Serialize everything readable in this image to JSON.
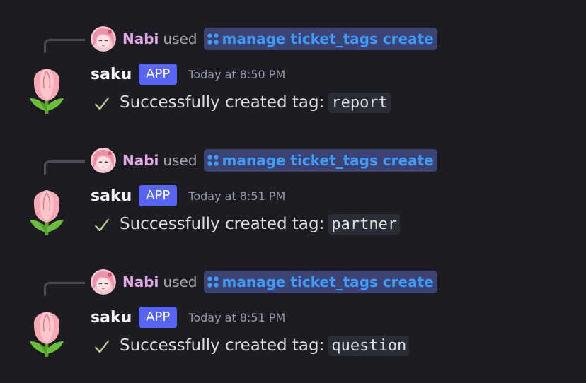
{
  "colors": {
    "background": "#1c1c22",
    "reply_user": "#e3a8e8",
    "command_text": "#3e9cf8",
    "command_bg": "#3c4272",
    "app_badge": "#5865f2",
    "check": "#b5cc8e"
  },
  "messages": [
    {
      "reply": {
        "user": "Nabi",
        "used_text": "used",
        "command": "manage ticket_tags create",
        "avatar_icon": "anime-girl-avatar"
      },
      "author": "saku",
      "badge": "APP",
      "timestamp": "Today at 8:50 PM",
      "check_icon": "check-mark-icon",
      "text": "Successfully created tag:",
      "code": "report",
      "avatar_icon": "tulip-avatar"
    },
    {
      "reply": {
        "user": "Nabi",
        "used_text": "used",
        "command": "manage ticket_tags create",
        "avatar_icon": "anime-girl-avatar"
      },
      "author": "saku",
      "badge": "APP",
      "timestamp": "Today at 8:51 PM",
      "check_icon": "check-mark-icon",
      "text": "Successfully created tag:",
      "code": "partner",
      "avatar_icon": "tulip-avatar"
    },
    {
      "reply": {
        "user": "Nabi",
        "used_text": "used",
        "command": "manage ticket_tags create",
        "avatar_icon": "anime-girl-avatar"
      },
      "author": "saku",
      "badge": "APP",
      "timestamp": "Today at 8:51 PM",
      "check_icon": "check-mark-icon",
      "text": "Successfully created tag:",
      "code": "question",
      "avatar_icon": "tulip-avatar"
    }
  ]
}
